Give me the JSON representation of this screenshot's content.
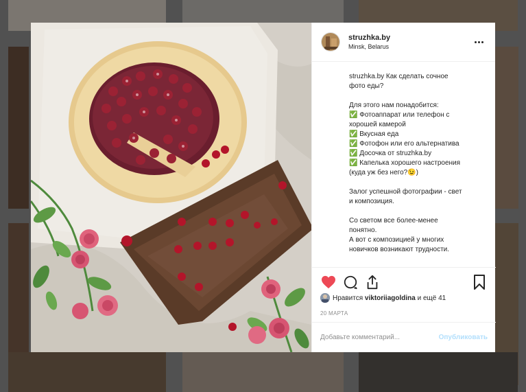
{
  "post": {
    "username": "struzhka.by",
    "location": "Minsk, Belarus",
    "caption_user": "struzhka.by",
    "caption_lines": [
      "Как сделать сочное",
      "фото еды?",
      "",
      "Для этого нам понадобится:",
      "✅ Фотоаппарат или телефон с",
      "хорошей камерой",
      "✅ Вкусная еда",
      "✅ Фотофон или его альтернатива",
      "✅ Досочка от struzhka.by",
      "✅ Капелька хорошего настроения",
      "(куда уж без него?😉)",
      "",
      "Залог успешной фотографии - свет",
      "и композиция.",
      "",
      "Со светом все более-менее",
      "понятно.",
      "А вот с композицией у многих",
      "новичков возникают трудности."
    ],
    "likes_prefix": "Нравится",
    "likes_user": "viktoriiagoldina",
    "likes_suffix": "и ещё 41",
    "date": "20 МАРТА",
    "comment_placeholder": "Добавьте комментарий...",
    "publish_label": "Опубликовать"
  },
  "icons": {
    "like": "heart-icon",
    "comment": "comment-icon",
    "share": "share-icon",
    "save": "bookmark-icon",
    "more": "more-options-icon"
  },
  "colors": {
    "like_red": "#ed4956",
    "text": "#262626",
    "muted": "#8e8e8e",
    "publish_disabled": "#b2dffc"
  }
}
